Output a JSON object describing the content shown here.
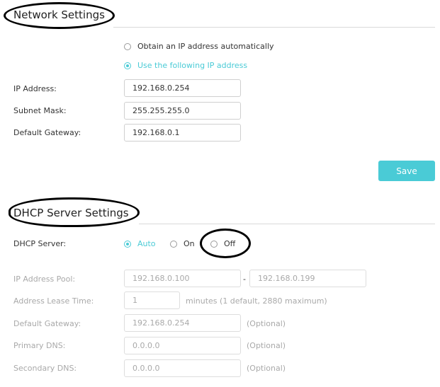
{
  "network": {
    "title": "Network Settings",
    "mode_options": [
      {
        "label": "Obtain an IP address automatically",
        "selected": false
      },
      {
        "label": "Use the following IP address",
        "selected": true
      }
    ],
    "ip_address": {
      "label": "IP Address:",
      "value": "192.168.0.254"
    },
    "subnet_mask": {
      "label": "Subnet Mask:",
      "value": "255.255.255.0"
    },
    "default_gateway": {
      "label": "Default Gateway:",
      "value": "192.168.0.1"
    },
    "save_label": "Save"
  },
  "dhcp": {
    "title": "DHCP Server Settings",
    "server_label": "DHCP Server:",
    "server_options": [
      {
        "label": "Auto",
        "selected": true
      },
      {
        "label": "On",
        "selected": false
      },
      {
        "label": "Off",
        "selected": false
      }
    ],
    "ip_pool": {
      "label": "IP Address Pool:",
      "start": "192.168.0.100",
      "separator": "-",
      "end": "192.168.0.199"
    },
    "lease_time": {
      "label": "Address Lease Time:",
      "value": "1",
      "hint": "minutes (1 default, 2880 maximum)"
    },
    "default_gateway": {
      "label": "Default Gateway:",
      "value": "192.168.0.254",
      "hint": "(Optional)"
    },
    "primary_dns": {
      "label": "Primary DNS:",
      "value": "0.0.0.0",
      "hint": "(Optional)"
    },
    "secondary_dns": {
      "label": "Secondary DNS:",
      "value": "0.0.0.0",
      "hint": "(Optional)"
    }
  },
  "colors": {
    "accent": "#4acbd6",
    "disabled_text": "#a9a9a9",
    "divider": "#d9d9d9",
    "annotation": "#000000"
  }
}
